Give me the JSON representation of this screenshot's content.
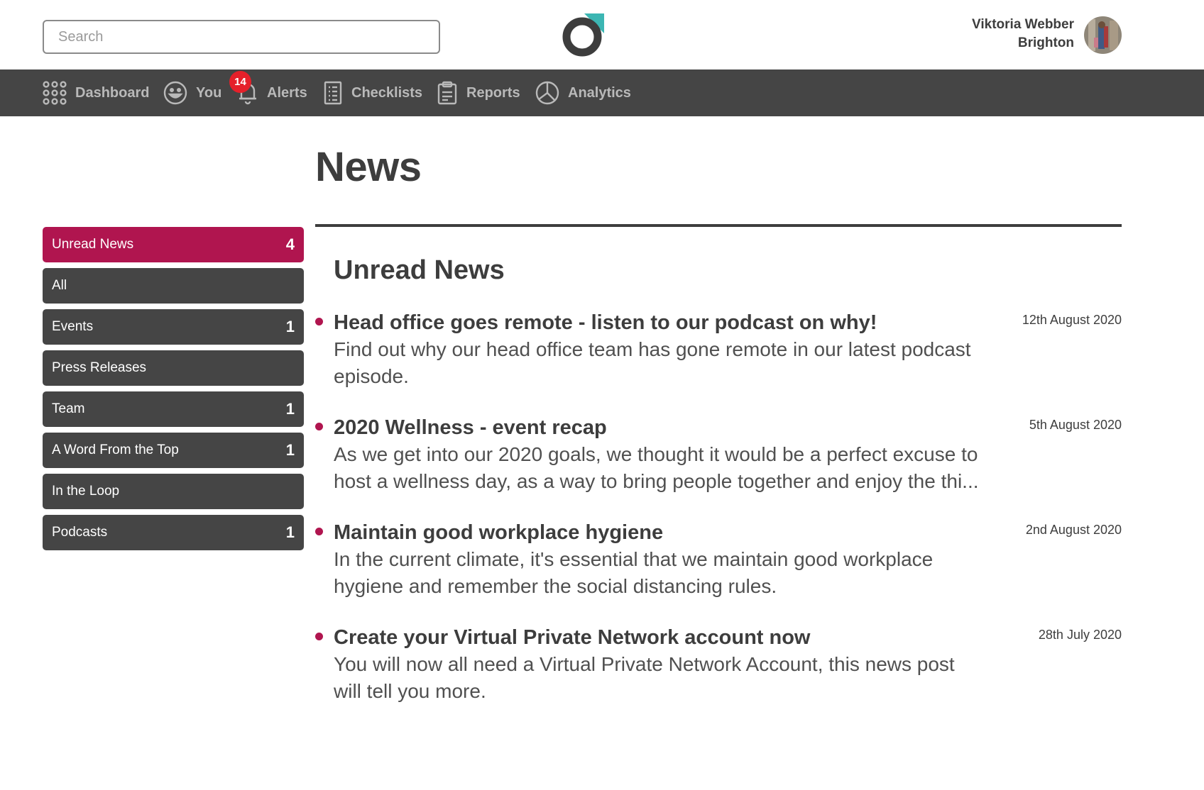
{
  "header": {
    "search_placeholder": "Search",
    "user_name": "Viktoria Webber",
    "user_location": "Brighton"
  },
  "nav": {
    "items": [
      {
        "label": "Dashboard",
        "icon": "grid-dots-icon"
      },
      {
        "label": "You",
        "icon": "smiley-icon"
      },
      {
        "label": "Alerts",
        "icon": "bell-icon"
      },
      {
        "label": "Checklists",
        "icon": "checklist-icon"
      },
      {
        "label": "Reports",
        "icon": "clipboard-icon"
      },
      {
        "label": "Analytics",
        "icon": "pie-chart-icon"
      }
    ],
    "alerts_badge": "14"
  },
  "page": {
    "title": "News",
    "section_title": "Unread News"
  },
  "sidebar": {
    "items": [
      {
        "label": "Unread News",
        "count": "4",
        "active": true
      },
      {
        "label": "All",
        "count": ""
      },
      {
        "label": "Events",
        "count": "1"
      },
      {
        "label": "Press Releases",
        "count": ""
      },
      {
        "label": "Team",
        "count": "1"
      },
      {
        "label": "A Word From the Top",
        "count": "1"
      },
      {
        "label": "In the Loop",
        "count": ""
      },
      {
        "label": "Podcasts",
        "count": "1"
      }
    ]
  },
  "news": [
    {
      "title": "Head office goes remote - listen to our podcast on why!",
      "summary": "Find out why our head office team has gone remote in our latest podcast episode.",
      "date": "12th August 2020"
    },
    {
      "title": "2020 Wellness - event recap",
      "summary": "As we get into our 2020 goals, we thought it would be a perfect excuse to host a wellness day, as a way to bring people together and enjoy the thi...",
      "date": "5th August 2020"
    },
    {
      "title": "Maintain good workplace hygiene",
      "summary": "In the current climate, it's essential that we maintain good workplace hygiene and remember the social distancing rules.",
      "date": "2nd August 2020"
    },
    {
      "title": "Create your Virtual Private Network account now",
      "summary": "You will now all need a Virtual Private Network Account, this news post will tell you more.",
      "date": "28th July 2020"
    }
  ],
  "colors": {
    "accent": "#b0154f",
    "nav_bg": "#454545",
    "badge": "#e5202a",
    "logo_teal": "#3cb6b3"
  }
}
